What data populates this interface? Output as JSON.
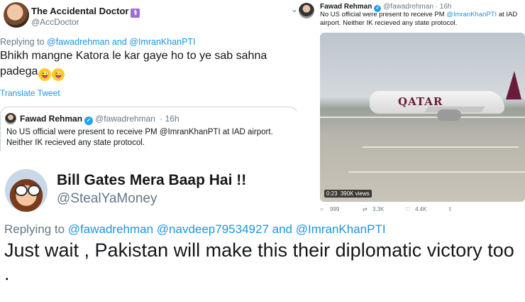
{
  "panel1": {
    "name": "The Accidental Doctor",
    "name_icon": "medical-symbol-icon",
    "handle": "@AccDoctor",
    "replying_prefix": "Replying to",
    "replying_users": "@fawadrehman and @ImranKhanPTI",
    "text": "Bhikh mangne Katora le kar gaye ho to ye sab sahna padega",
    "emoji": "crazy-face-icon",
    "translate": "Translate Tweet",
    "quoted": {
      "name": "Fawad Rehman",
      "handle": "@fawadrehman",
      "time": "· 16h",
      "text": "No US official were present to receive PM @ImranKhanPTI at IAD airport. Neither IK recieved any state protocol."
    }
  },
  "panel2": {
    "name": "Fawad Rehman",
    "handle": "@fawadrehman",
    "time": "· 16h",
    "text_pre": "No US official were present to receive PM",
    "mention": "@ImranKhanPTI",
    "text_post": "at IAD airport. Neither IK recieved any state protocol.",
    "video_duration": "0:23",
    "video_views": "390K views",
    "plane_text": "QATAR",
    "actions": [
      "999",
      "3.3K",
      "4.4K"
    ]
  },
  "panel3": {
    "name": "Bill Gates Mera Baap Hai !!",
    "handle": "@StealYaMoney"
  },
  "panel4": {
    "replying_prefix": "Replying to",
    "replying_users": "@fawadrehman @navdeep79534927 and @ImranKhanPTI",
    "text": "Just wait , Pakistan will make this their diplomatic victory too ."
  }
}
